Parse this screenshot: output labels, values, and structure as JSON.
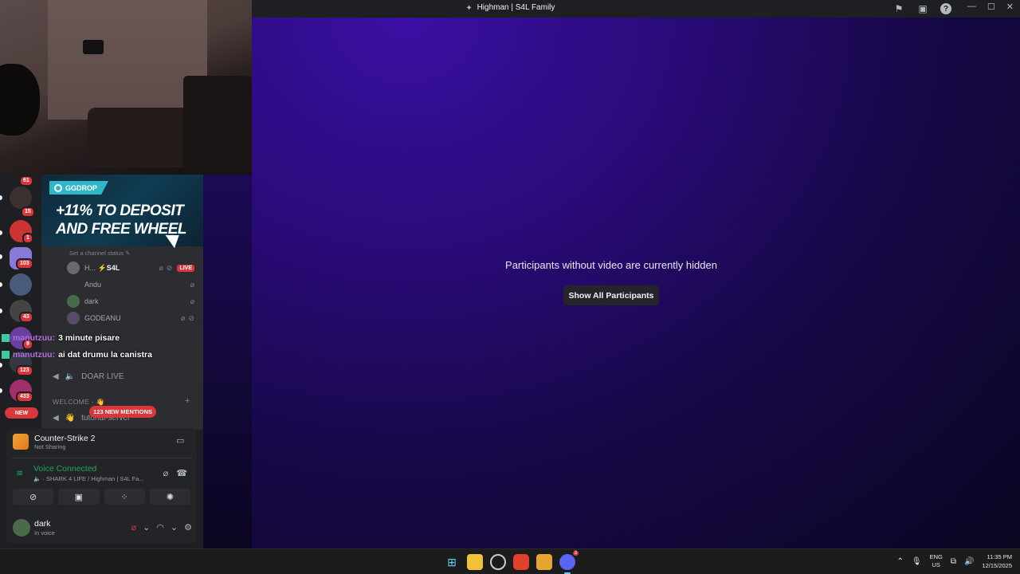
{
  "window": {
    "title": "Highman | S4L Family"
  },
  "stage": {
    "hidden_message": "Participants without video are currently hidden",
    "show_all_label": "Show All Participants"
  },
  "guilds": {
    "badges": [
      "61",
      "15",
      "1",
      "103",
      "43",
      "9",
      "123",
      "433",
      "NEW"
    ],
    "new_mentions_label": "123 NEW MENTIONS"
  },
  "channel_list": {
    "banner": {
      "brand": "GGDROP",
      "headline": "+11% TO DEPOSIT AND FREE WHEEL"
    },
    "status_placeholder": "Set a channel status",
    "members": [
      {
        "name": "H...",
        "tag": "S4L",
        "live": "LIVE"
      },
      {
        "name": "Andu"
      },
      {
        "name": "dark"
      },
      {
        "name": "GODEANU"
      }
    ],
    "stage_channel": "DOAR LIVE",
    "section_header": "WELCOME -",
    "partial_channel": "tutorial-server"
  },
  "overlay_chat": [
    {
      "author": "manutzuu:",
      "text": "3 minute pisare"
    },
    {
      "author": "manutzuu:",
      "text": "ai dat drumu la canistra"
    }
  ],
  "activity": {
    "game": "Counter-Strike 2",
    "status": "Not Sharing"
  },
  "voice": {
    "title": "Voice Connected",
    "path": "SHARK 4 LIFE / Highman | S4L Fa..."
  },
  "user": {
    "name": "dark",
    "status": "In voice"
  },
  "taskbar": {
    "lang_top": "ENG",
    "lang_bottom": "US",
    "time": "11:35 PM",
    "date": "12/15/2025",
    "discord_badge": "3"
  },
  "colors": {
    "accent_red": "#da373c",
    "voice_green": "#23a55a",
    "stage_purple": "#2a0b7a"
  }
}
